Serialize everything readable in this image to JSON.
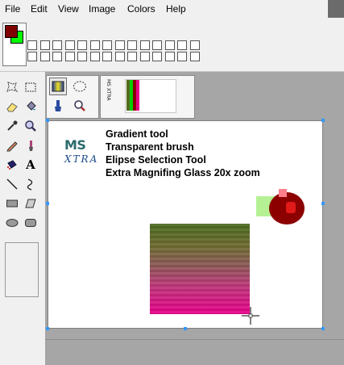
{
  "menubar": {
    "items": [
      "File",
      "Edit",
      "View",
      "Image",
      "Colors",
      "Help"
    ]
  },
  "palette": {
    "foreground_color": "#800000",
    "background_color": "#00ff00",
    "swatch_count": 28
  },
  "toolbox": {
    "tools": [
      "free-form-select-icon",
      "rect-select-icon",
      "eraser-icon",
      "fill-bucket-icon",
      "color-picker-icon",
      "magnifier-icon",
      "pencil-icon",
      "brush-icon",
      "airbrush-icon",
      "text-icon",
      "line-icon",
      "curve-icon",
      "rectangle-icon",
      "polygon-icon",
      "ellipse-icon",
      "rounded-rect-icon"
    ]
  },
  "xtra_tools": {
    "tools": [
      "gradient-tool-icon",
      "ellipse-selection-icon",
      "transparent-brush-icon",
      "extra-magnifier-icon"
    ]
  },
  "preview": {
    "vertical_label": "MS XTRA"
  },
  "canvas": {
    "logo_ms": "MS",
    "logo_xtra": "XTRA",
    "features": [
      "Gradient tool",
      "Transparent brush",
      "Elipse Selection Tool",
      "Extra Magnifing Glass 20x zoom"
    ]
  }
}
